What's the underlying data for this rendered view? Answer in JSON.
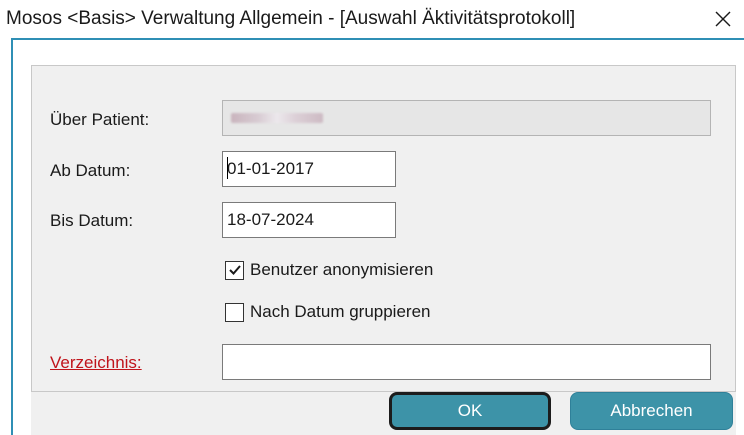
{
  "window": {
    "title": "Mosos <Basis> Verwaltung Allgemein - [Auswahl Äktivitätsprotokoll]"
  },
  "form": {
    "patient_label": "Über Patient:",
    "patient_value": "",
    "from_date_label": "Ab Datum:",
    "from_date_value": "01-01-2017",
    "to_date_label": "Bis Datum:",
    "to_date_value": "18-07-2024",
    "anonymize_label": "Benutzer anonymisieren",
    "anonymize_checked": true,
    "group_by_date_label": "Nach Datum gruppieren",
    "group_by_date_checked": false,
    "directory_label": "Verzeichnis:",
    "directory_value": ""
  },
  "buttons": {
    "ok_label": "OK",
    "cancel_label": "Abbrechen"
  },
  "colors": {
    "accent": "#3d93a8",
    "frame_border": "#2f8fb5",
    "link_red": "#c0141b"
  },
  "icons": {
    "close": "close-icon",
    "checkmark": "checkmark-icon"
  }
}
